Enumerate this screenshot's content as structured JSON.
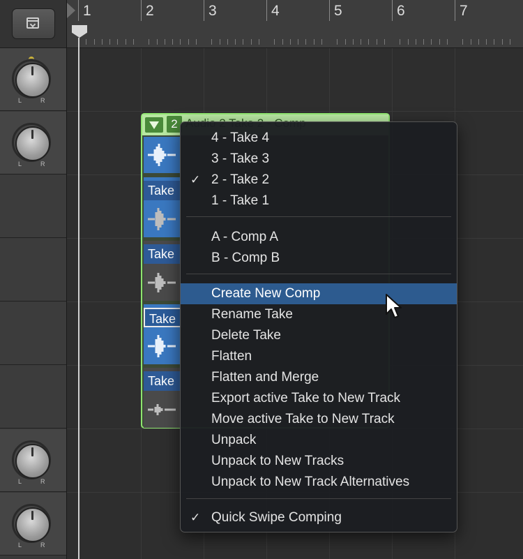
{
  "ruler": {
    "bars": [
      "1",
      "2",
      "3",
      "4",
      "5",
      "6",
      "7"
    ]
  },
  "track_header": {
    "pan_label_left": "L",
    "pan_label_right": "R"
  },
  "region": {
    "take_number": "2",
    "title": "Audio 2 Take 2 - Comp"
  },
  "take_lanes": [
    {
      "label": "Take",
      "state": "active",
      "outlined": false
    },
    {
      "label": "Take",
      "state": "inactive",
      "outlined": false
    },
    {
      "label": "Take",
      "state": "active",
      "outlined": true
    },
    {
      "label": "Take",
      "state": "inactive",
      "outlined": false
    }
  ],
  "context_menu": {
    "takes": [
      {
        "label": "4 - Take 4",
        "checked": false
      },
      {
        "label": "3 - Take 3",
        "checked": false
      },
      {
        "label": "2 - Take 2",
        "checked": true
      },
      {
        "label": "1 - Take 1",
        "checked": false
      }
    ],
    "comps": [
      {
        "label": "A - Comp A"
      },
      {
        "label": "B - Comp B"
      }
    ],
    "actions": [
      {
        "label": "Create New Comp",
        "highlighted": true
      },
      {
        "label": "Rename Take"
      },
      {
        "label": "Delete Take"
      },
      {
        "label": "Flatten"
      },
      {
        "label": "Flatten and Merge"
      },
      {
        "label": "Export active Take to New Track"
      },
      {
        "label": "Move active Take to New Track"
      },
      {
        "label": "Unpack"
      },
      {
        "label": "Unpack to New Tracks"
      },
      {
        "label": "Unpack to New Track Alternatives"
      }
    ],
    "options": [
      {
        "label": "Quick Swipe Comping",
        "checked": true
      }
    ],
    "checkmark": "✓"
  },
  "colors": {
    "region_outline": "#8ee56f",
    "region_header": "#b8e8a2",
    "menu_highlight": "#2d5b8f",
    "take_active": "#3a78c0"
  }
}
